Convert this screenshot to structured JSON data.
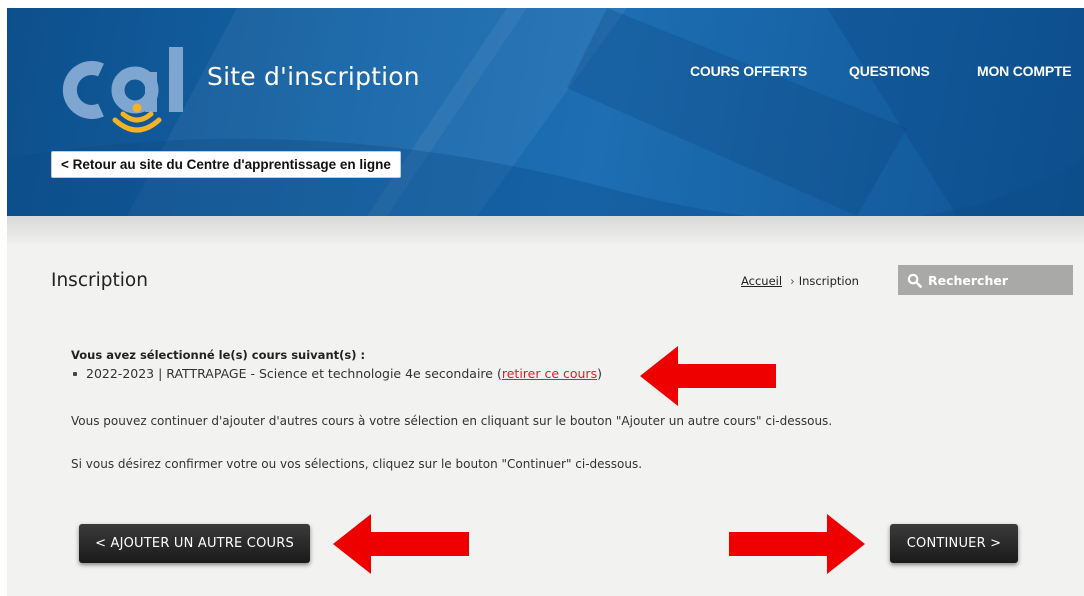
{
  "header": {
    "logo_text": "cal",
    "site_title": "Site d'inscription",
    "back_button": "< Retour au site du Centre d'apprentissage en ligne",
    "nav": [
      {
        "label": "COURS OFFERTS"
      },
      {
        "label": "QUESTIONS"
      },
      {
        "label": "MON COMPTE"
      }
    ]
  },
  "page": {
    "heading": "Inscription",
    "breadcrumb": {
      "home": "Accueil",
      "separator": "›",
      "current": "Inscription"
    },
    "search_placeholder": "Rechercher"
  },
  "content": {
    "selection_heading": "Vous avez sélectionné le(s) cours suivant(s) :",
    "course": "2022-2023 | RATTRAPAGE - Science et technologie 4e secondaire",
    "remove_open": "(",
    "remove_link": "retirer ce cours",
    "remove_close": ")",
    "para_add": "Vous pouvez continuer d'ajouter d'autres cours à votre sélection en cliquant sur le bouton \"Ajouter un autre cours\" ci-dessous.",
    "para_confirm": "Si vous désirez confirmer votre ou vos sélections, cliquez sur le bouton \"Continuer\" ci-dessous."
  },
  "buttons": {
    "add_course": "< AJOUTER UN AUTRE COURS",
    "continue": "CONTINUER >"
  },
  "colors": {
    "header_blue": "#1565a8",
    "link_red": "#d3232a",
    "annotation_arrow": "#ee0000",
    "logo_yellow": "#f5b324",
    "logo_pale_blue": "#7ea6d0"
  },
  "icons": {
    "search": "magnifier-icon",
    "annotation": "red-arrow-icon"
  }
}
